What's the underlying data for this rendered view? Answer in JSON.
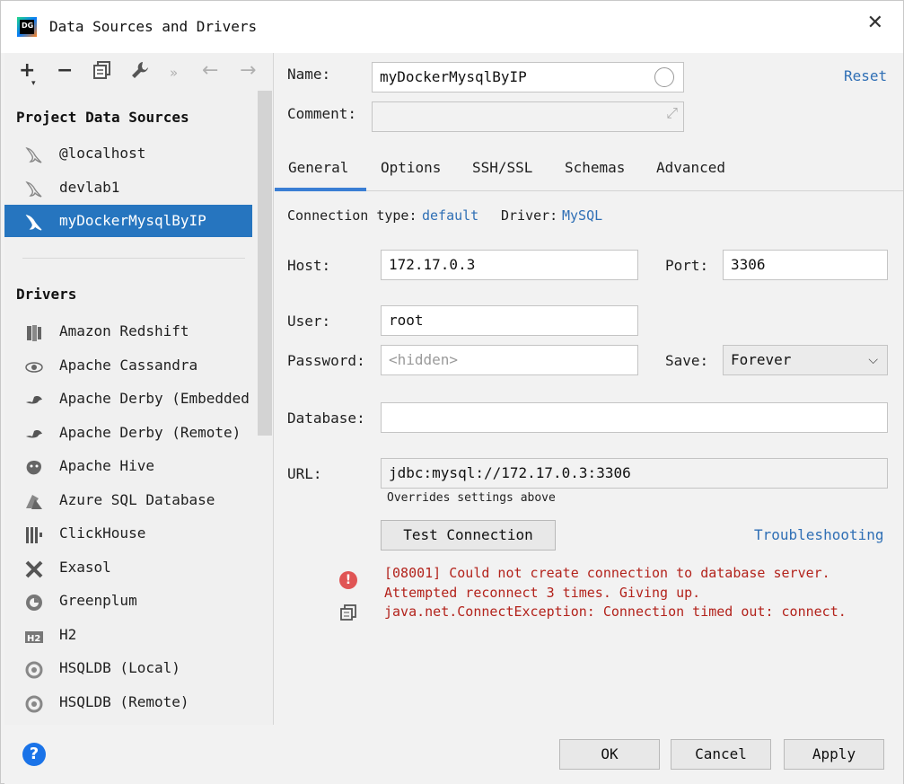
{
  "window": {
    "title": "Data Sources and Drivers",
    "app_icon_text": "DG"
  },
  "toolbar": {
    "icons": [
      "plus-icon",
      "minus-icon",
      "copy-icon",
      "wrench-icon",
      "more-icon",
      "back-icon",
      "forward-icon"
    ]
  },
  "project_sources": {
    "heading": "Project Data Sources",
    "items": [
      {
        "label": "@localhost",
        "icon": "mysql-icon",
        "selected": false
      },
      {
        "label": "devlab1",
        "icon": "mysql-icon",
        "selected": false
      },
      {
        "label": "myDockerMysqlByIP",
        "icon": "mysql-icon",
        "selected": true
      }
    ]
  },
  "drivers": {
    "heading": "Drivers",
    "items": [
      {
        "label": "Amazon Redshift",
        "icon": "redshift-icon"
      },
      {
        "label": "Apache Cassandra",
        "icon": "cassandra-icon"
      },
      {
        "label": "Apache Derby (Embedded",
        "icon": "derby-icon"
      },
      {
        "label": "Apache Derby (Remote)",
        "icon": "derby-icon"
      },
      {
        "label": "Apache Hive",
        "icon": "hive-icon"
      },
      {
        "label": "Azure SQL Database",
        "icon": "azure-icon"
      },
      {
        "label": "ClickHouse",
        "icon": "clickhouse-icon"
      },
      {
        "label": "Exasol",
        "icon": "exasol-icon"
      },
      {
        "label": "Greenplum",
        "icon": "greenplum-icon"
      },
      {
        "label": "H2",
        "icon": "h2-icon"
      },
      {
        "label": "HSQLDB (Local)",
        "icon": "hsqldb-icon"
      },
      {
        "label": "HSQLDB (Remote)",
        "icon": "hsqldb-icon"
      }
    ]
  },
  "form": {
    "name_label": "Name:",
    "name_value": "myDockerMysqlByIP",
    "reset_link": "Reset",
    "comment_label": "Comment:",
    "comment_value": "",
    "tabs": [
      "General",
      "Options",
      "SSH/SSL",
      "Schemas",
      "Advanced"
    ],
    "active_tab": "General",
    "connection_type_label": "Connection type:",
    "connection_type_value": "default",
    "driver_label": "Driver:",
    "driver_value": "MySQL",
    "host_label": "Host:",
    "host_value": "172.17.0.3",
    "port_label": "Port:",
    "port_value": "3306",
    "user_label": "User:",
    "user_value": "root",
    "password_label": "Password:",
    "password_placeholder": "<hidden>",
    "save_label": "Save:",
    "save_value": "Forever",
    "database_label": "Database:",
    "database_value": "",
    "url_label": "URL:",
    "url_value": "jdbc:mysql://172.17.0.3:3306",
    "url_note": "Overrides settings above",
    "test_button": "Test Connection",
    "troubleshooting_link": "Troubleshooting",
    "error_lines": [
      "[08001] Could not create connection to database server.",
      "Attempted reconnect 3 times. Giving up.",
      "java.net.ConnectException: Connection timed out: connect."
    ]
  },
  "footer": {
    "ok": "OK",
    "cancel": "Cancel",
    "apply": "Apply",
    "help": "?"
  },
  "colors": {
    "selection": "#2675bf",
    "link": "#2f6fb5",
    "error": "#b3231c",
    "tab_accent": "#3a7ed4"
  }
}
